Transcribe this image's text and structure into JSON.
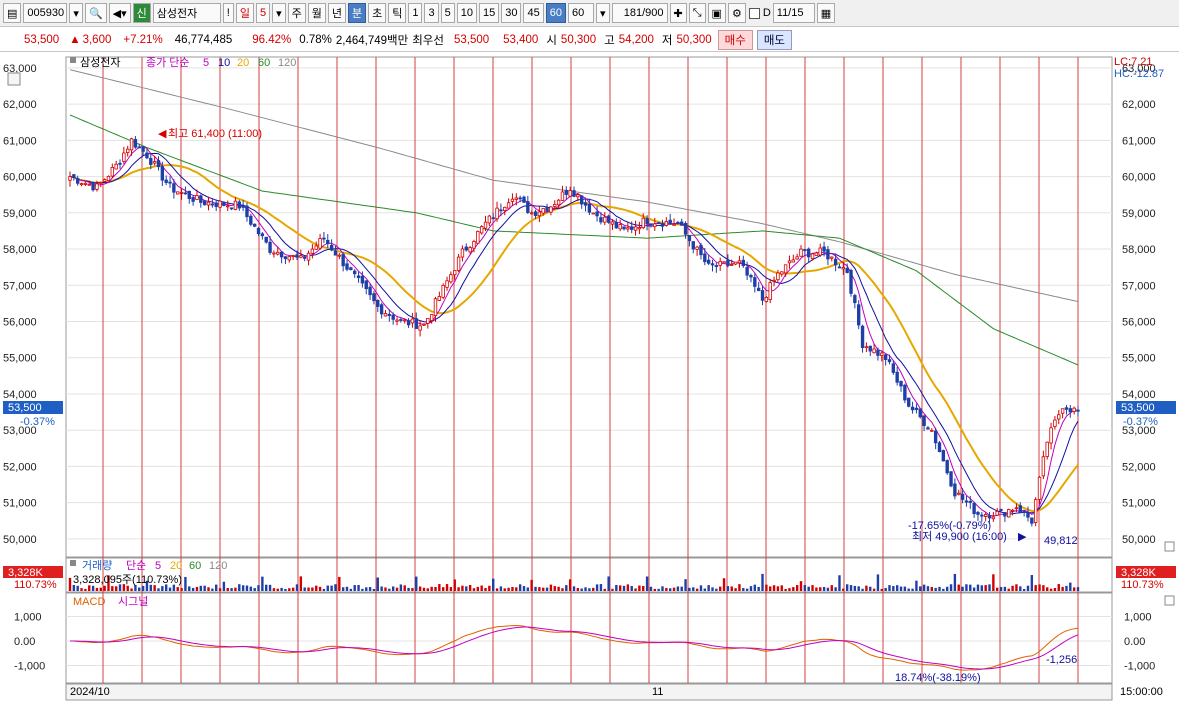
{
  "toolbar": {
    "code": "005930",
    "stock_tag": "신",
    "stock_name": "삼성전자",
    "excl": "!",
    "period_day": "일",
    "day_value": "5",
    "btn_week": "주",
    "btn_month": "월",
    "btn_year": "년",
    "btn_min": "분",
    "btn_sec": "초",
    "btn_tick": "틱",
    "intervals": [
      "1",
      "3",
      "5",
      "10",
      "15",
      "30",
      "45",
      "60"
    ],
    "interval_value": "60",
    "count": "181",
    "count_total": "/900",
    "check_label": "D",
    "date": "11/15"
  },
  "quote": {
    "price": "53,500",
    "change": "3,600",
    "change_pct": "+7.21%",
    "volume": "46,774,485",
    "vol_ratio": "96.42%",
    "turnover_pct": "0.78%",
    "amount": "2,464,749백만",
    "best_label": "최우선",
    "ask": "53,500",
    "bid": "53,400",
    "open_label": "시",
    "open": "50,300",
    "high_label": "고",
    "high": "54,200",
    "low_label": "저",
    "low": "50,300",
    "buy_label": "매수",
    "sell_label": "매도"
  },
  "legend": {
    "name": "삼성전자",
    "ma_label": "종가 단순",
    "ma": [
      "5",
      "10",
      "20",
      "60",
      "120"
    ],
    "lc": "LC:7.21",
    "hc": "HC:-12.87",
    "price_tag": "53,500",
    "price_tag_pct": "-0.37%",
    "high_note": "최고 61,400 (11:00)",
    "low_note_pct": "-17.65%(-0.79%)",
    "low_note": "최저 49,900 (16:00)",
    "low_line_val": "49,812"
  },
  "volume_legend": {
    "title": "거래량",
    "ma_label": "단순",
    "ma": [
      "5",
      "20",
      "60",
      "120"
    ],
    "value": "3,328,095주(110.73%)",
    "tag": "3,328K",
    "tag_pct": "110.73%"
  },
  "macd_legend": {
    "macd": "MACD",
    "signal": "시그널",
    "low_note": "18.74%(-38.19%)",
    "end_val": "-1,256"
  },
  "axis": {
    "date_left": "2024/10",
    "date_mid": "11",
    "time_right": "15:00:00"
  },
  "colors": {
    "up": "#d40000",
    "down": "#1f3fa8",
    "ma5": "#c000c0",
    "ma10": "#1010a0",
    "ma20": "#e6a800",
    "ma60": "#2a8a2a",
    "ma120": "#8a8a8a",
    "vline": "#d44040"
  },
  "chart_data": {
    "type": "candlestick",
    "price_ticks": [
      63000,
      62000,
      61000,
      60000,
      59000,
      58000,
      57000,
      56000,
      55000,
      54000,
      53000,
      52000,
      51000,
      50000
    ],
    "price_tick_labels": [
      "63,000",
      "62,000",
      "61,000",
      "60,000",
      "59,000",
      "58,000",
      "57,000",
      "56,000",
      "55,000",
      "54,000",
      "53,000",
      "52,000",
      "51,000",
      "50,000"
    ],
    "macd_ticks": [
      1000,
      0,
      -1000
    ],
    "macd_tick_labels": [
      "1,000",
      "0.00",
      "-1,000"
    ],
    "ylim": [
      49500,
      63300
    ],
    "keypoints": [
      [
        0,
        60000
      ],
      [
        7,
        59700
      ],
      [
        12,
        60300
      ],
      [
        16,
        61000
      ],
      [
        20,
        60600
      ],
      [
        26,
        59700
      ],
      [
        34,
        59300
      ],
      [
        44,
        59200
      ],
      [
        52,
        58000
      ],
      [
        60,
        57700
      ],
      [
        66,
        58300
      ],
      [
        72,
        57500
      ],
      [
        80,
        56400
      ],
      [
        86,
        56000
      ],
      [
        92,
        55900
      ],
      [
        96,
        56700
      ],
      [
        102,
        57900
      ],
      [
        108,
        58700
      ],
      [
        115,
        59500
      ],
      [
        120,
        59000
      ],
      [
        125,
        59200
      ],
      [
        130,
        59700
      ],
      [
        136,
        59000
      ],
      [
        144,
        58500
      ],
      [
        150,
        58800
      ],
      [
        158,
        58700
      ],
      [
        166,
        57500
      ],
      [
        174,
        57600
      ],
      [
        180,
        56600
      ],
      [
        184,
        57300
      ],
      [
        190,
        57900
      ],
      [
        196,
        57900
      ],
      [
        202,
        57400
      ],
      [
        206,
        55400
      ],
      [
        212,
        55000
      ],
      [
        218,
        53700
      ],
      [
        224,
        53000
      ],
      [
        230,
        51300
      ],
      [
        236,
        50700
      ],
      [
        242,
        50700
      ],
      [
        246,
        50900
      ],
      [
        250,
        50500
      ],
      [
        254,
        52700
      ],
      [
        258,
        53700
      ],
      [
        262,
        53500
      ]
    ],
    "ma60_keypoints": [
      [
        0,
        61700
      ],
      [
        20,
        60800
      ],
      [
        50,
        59600
      ],
      [
        90,
        59000
      ],
      [
        110,
        58500
      ],
      [
        150,
        58300
      ],
      [
        180,
        58500
      ],
      [
        200,
        58300
      ],
      [
        220,
        57400
      ],
      [
        240,
        55800
      ],
      [
        262,
        54800
      ]
    ],
    "ma120_keypoints": [
      [
        0,
        62950
      ],
      [
        40,
        61900
      ],
      [
        80,
        60800
      ],
      [
        110,
        59900
      ],
      [
        150,
        59300
      ],
      [
        180,
        58700
      ],
      [
        200,
        58200
      ],
      [
        230,
        57300
      ],
      [
        262,
        56550
      ]
    ]
  }
}
